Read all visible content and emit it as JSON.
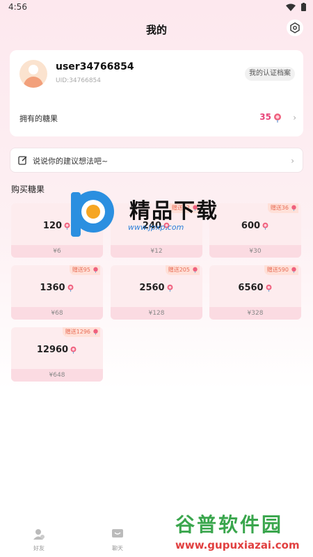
{
  "status": {
    "time": "4:56"
  },
  "header": {
    "title": "我的"
  },
  "profile": {
    "username": "user34766854",
    "uid": "UID:34766854",
    "cert_label": "我的认证档案",
    "candy_label": "拥有的糖果",
    "candy_count": "35"
  },
  "suggest": {
    "text": "说说你的建议想法吧~"
  },
  "shop": {
    "title": "购买糖果",
    "items": [
      {
        "amount": "120",
        "price": "¥6",
        "badge": ""
      },
      {
        "amount": "240",
        "price": "¥12",
        "badge": "赠送12"
      },
      {
        "amount": "600",
        "price": "¥30",
        "badge": "赠送36"
      },
      {
        "amount": "1360",
        "price": "¥68",
        "badge": "赠送95"
      },
      {
        "amount": "2560",
        "price": "¥128",
        "badge": "赠送205"
      },
      {
        "amount": "6560",
        "price": "¥328",
        "badge": "赠送590"
      },
      {
        "amount": "12960",
        "price": "¥648",
        "badge": "赠送1296"
      }
    ]
  },
  "watermark": {
    "brand": "精品下载",
    "url": "www.jpxp.com"
  },
  "nav": {
    "friends": "好友",
    "chat": "聊天"
  },
  "brand_bottom": {
    "big": "谷普软件园",
    "url": "www.gupuxiazai.com"
  },
  "colors": {
    "accent": "#e8457a",
    "tile_bg": "#fdecee",
    "badge_text": "#e86c55"
  }
}
